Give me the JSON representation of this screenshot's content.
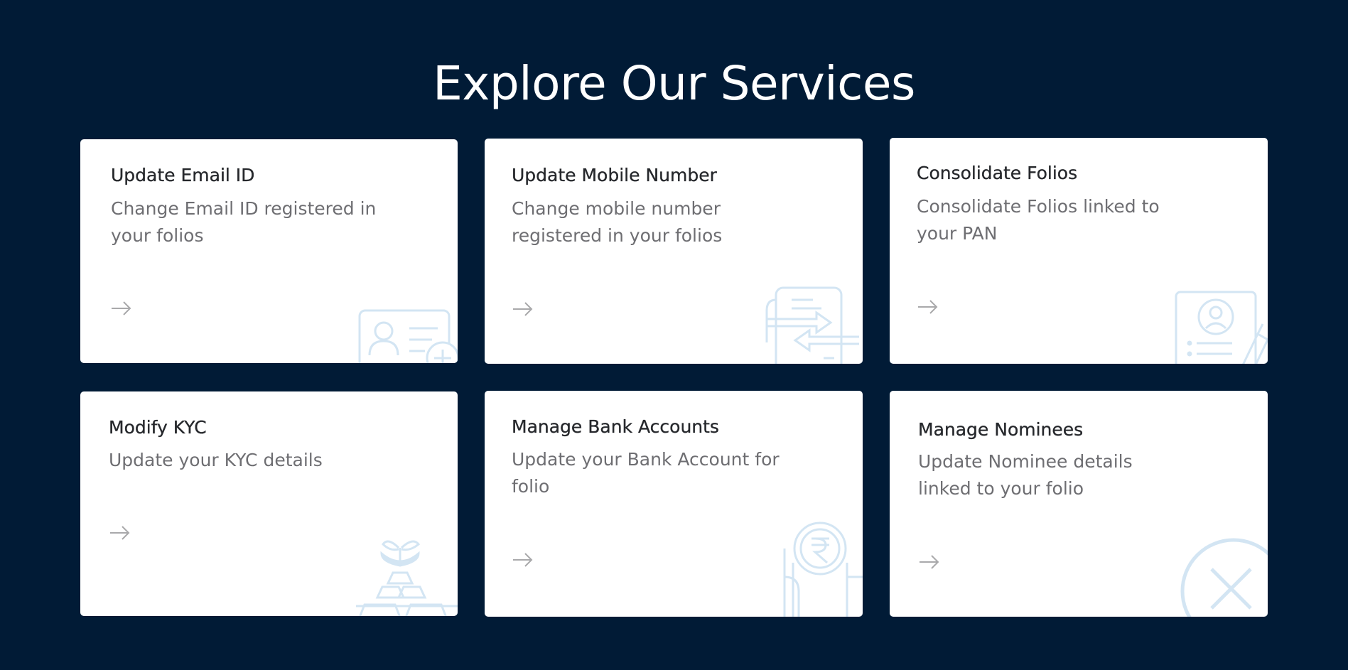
{
  "page": {
    "title": "Explore Our Services"
  },
  "colors": {
    "background": "#011b36",
    "card": "#ffffff",
    "card_title": "#26282c",
    "card_desc": "#6e6e72",
    "arrow": "#a9a9ab",
    "illustration": "#d3e5f3"
  },
  "services": [
    {
      "title": "Update Email ID",
      "description": "Change Email ID registered in your folios",
      "icon": "id-card-icon"
    },
    {
      "title": "Update Mobile Number",
      "description": "Change mobile number registered in your folios",
      "icon": "phone-transfer-icon"
    },
    {
      "title": "Consolidate Folios",
      "description": "Consolidate Folios linked to your PAN",
      "icon": "profile-document-icon"
    },
    {
      "title": "Modify KYC",
      "description": "Update your KYC details",
      "icon": "plant-gold-icon"
    },
    {
      "title": "Manage Bank Accounts",
      "description": "Update your Bank Account for folio",
      "icon": "rupee-coin-icon"
    },
    {
      "title": "Manage Nominees",
      "description": "Update Nominee details linked to your folio",
      "icon": "close-circle-icon"
    }
  ]
}
